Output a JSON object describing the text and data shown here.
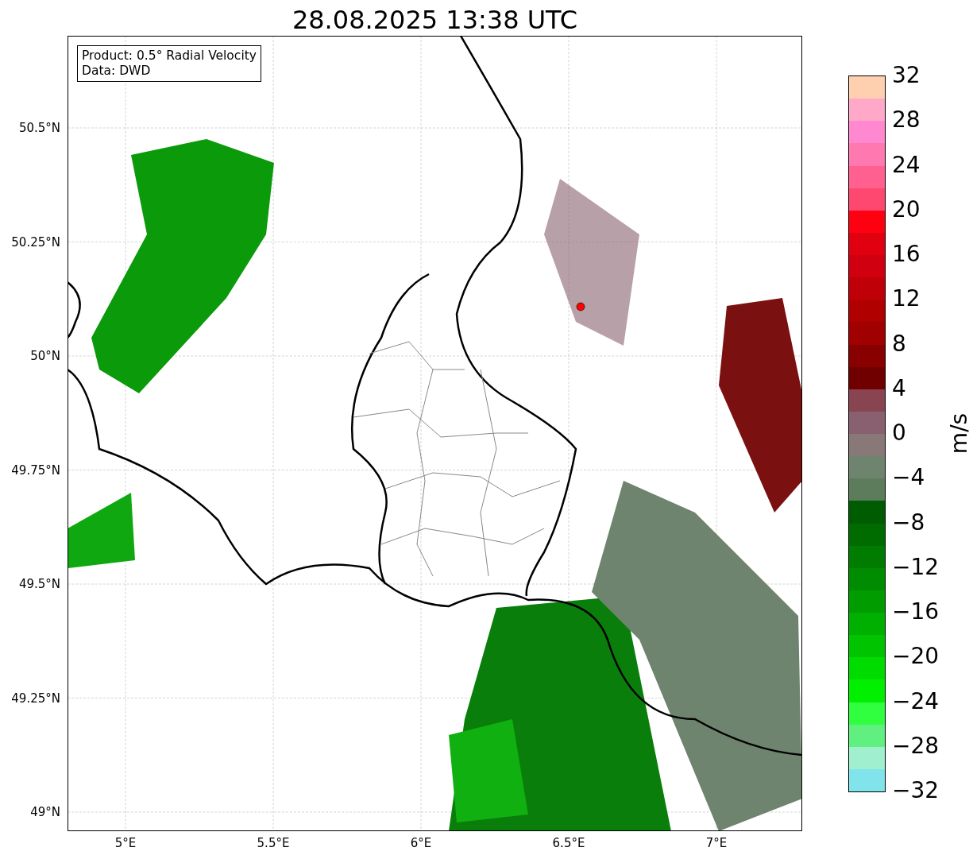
{
  "title": "28.08.2025 13:38 UTC",
  "map": {
    "info_box": [
      "Product: 0.5° Radial Velocity",
      "Data: DWD"
    ],
    "yticks": [
      "50.5°N",
      "50.25°N",
      "50°N",
      "49.75°N",
      "49.5°N",
      "49.25°N",
      "49°N"
    ],
    "xticks": [
      "5°E",
      "5.5°E",
      "6°E",
      "6.5°E",
      "7°E"
    ]
  },
  "colorbar": {
    "label": "m/s",
    "ticks": [
      "32",
      "28",
      "24",
      "20",
      "16",
      "12",
      "8",
      "4",
      "0",
      "−4",
      "−8",
      "−12",
      "−16",
      "−20",
      "−24",
      "−28",
      "−32"
    ],
    "segments": [
      {
        "color": "#ffd0b0"
      },
      {
        "color": "#ffa8c8"
      },
      {
        "color": "#ff88d0"
      },
      {
        "color": "#ff78b0"
      },
      {
        "color": "#ff6090"
      },
      {
        "color": "#ff4870"
      },
      {
        "color": "#ff0010"
      },
      {
        "color": "#e00010"
      },
      {
        "color": "#d00010"
      },
      {
        "color": "#c00008"
      },
      {
        "color": "#b00000"
      },
      {
        "color": "#a00000"
      },
      {
        "color": "#880000"
      },
      {
        "color": "#700000"
      },
      {
        "color": "#884450"
      },
      {
        "color": "#886070"
      },
      {
        "color": "#887878"
      },
      {
        "color": "#6e846e"
      },
      {
        "color": "#5c7c5c"
      },
      {
        "color": "#005c00"
      },
      {
        "color": "#006c00"
      },
      {
        "color": "#007c00"
      },
      {
        "color": "#008c00"
      },
      {
        "color": "#009c00"
      },
      {
        "color": "#00b000"
      },
      {
        "color": "#00c400"
      },
      {
        "color": "#00dc00"
      },
      {
        "color": "#00f000"
      },
      {
        "color": "#30ff40"
      },
      {
        "color": "#60f080"
      },
      {
        "color": "#a0f0d0"
      },
      {
        "color": "#80e4ea"
      }
    ]
  }
}
